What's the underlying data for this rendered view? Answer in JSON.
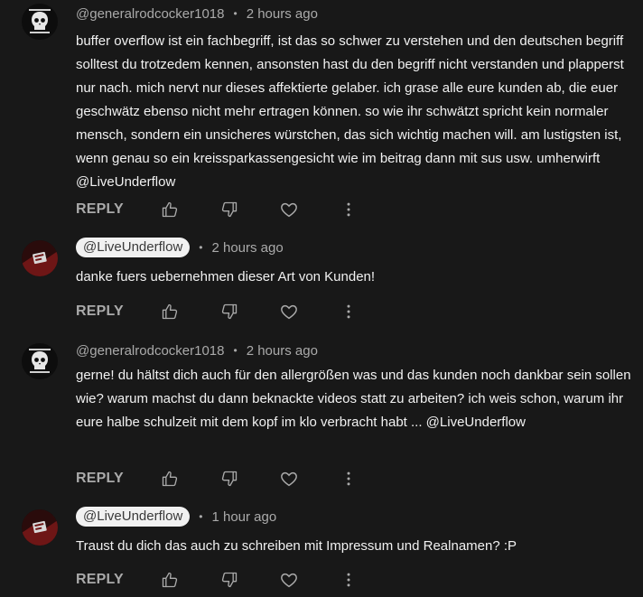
{
  "comments": [
    {
      "author": "@generalrodcocker1018",
      "author_style": "plain",
      "time": "2 hours ago",
      "text": "buffer overflow ist ein fachbegriff, ist das so schwer zu verstehen und den deutschen begriff solltest du trotzedem kennen, ansonsten hast du den begriff nicht verstanden und plapperst nur nach. mich nervt nur dieses affektierte gelaber. ich grase alle eure kunden ab, die euer geschwätz ebenso nicht mehr ertragen können. so wie ihr schwätzt spricht kein normaler mensch, sondern ein unsicheres würstchen, das sich wichtig machen will. am lustigsten ist, wenn genau so ein kreissparkassengesicht wie im beitrag dann mit sus usw. umherwirft  @LiveUnderflow",
      "reply_label": "REPLY",
      "avatar_icon": "skull-logo-avatar"
    },
    {
      "author": "@LiveUnderflow",
      "author_style": "pill",
      "time": "2 hours ago",
      "text": "danke fuers uebernehmen dieser Art von Kunden!",
      "reply_label": "REPLY",
      "avatar_icon": "channel-avatar"
    },
    {
      "author": "@generalrodcocker1018",
      "author_style": "plain",
      "time": "2 hours ago",
      "text": "gerne! du hältst dich auch für den allergrößen was und das kunden noch dankbar sein sollen wie? warum machst du dann beknackte videos statt zu arbeiten? ich weis schon, warum ihr eure halbe schulzeit mit dem kopf im klo verbracht habt ... @LiveUnderflow",
      "reply_label": "REPLY",
      "avatar_icon": "skull-logo-avatar"
    },
    {
      "author": "@LiveUnderflow",
      "author_style": "pill",
      "time": "1 hour ago",
      "text": "Traust du dich das auch zu schreiben mit Impressum und Realnamen? :P",
      "reply_label": "REPLY",
      "avatar_icon": "channel-avatar"
    }
  ],
  "separator": "•",
  "colors": {
    "background": "#181818",
    "text": "#f1f1f1",
    "secondary": "#aaaaaa",
    "pill_bg": "#f1f1f1",
    "avatar_red": "#5a1414"
  }
}
